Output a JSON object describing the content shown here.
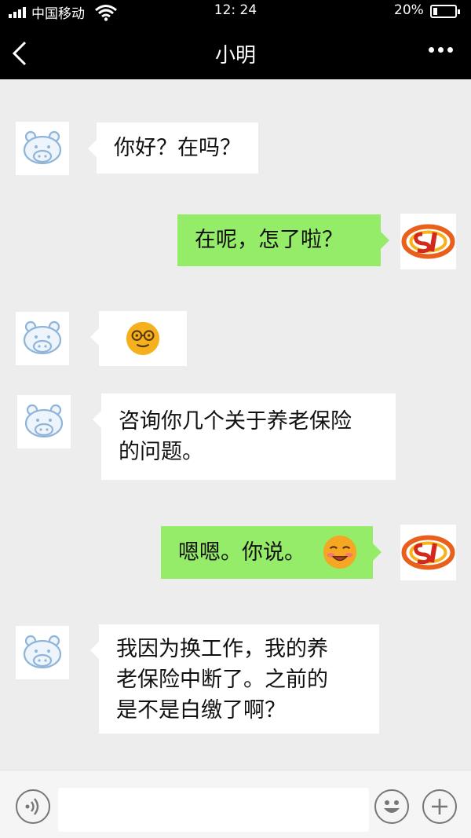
{
  "status_bar": {
    "carrier": "中国移动",
    "time": "12: 24",
    "battery": "20%",
    "battery_level": 0.2
  },
  "nav": {
    "title": "小明"
  },
  "messages": [
    {
      "from": "other",
      "text": "你好？在吗？"
    },
    {
      "from": "me",
      "text": "在呢，怎了啦？"
    },
    {
      "from": "other",
      "sticker": "nerd-glasses-emoji"
    },
    {
      "from": "other",
      "lines": [
        "咨询你几个关于养老保险",
        "的问题。"
      ]
    },
    {
      "from": "me",
      "text": "嗯嗯。你说。",
      "emoji": "blush-smile-emoji"
    },
    {
      "from": "other",
      "lines": [
        "我因为换工作，我的养",
        "老保险中断了。之前的",
        "是不是白缴了啊？"
      ]
    }
  ],
  "icons": {
    "back": "chevron-left-icon",
    "more": "more-dots-icon",
    "voice": "voice-icon",
    "emoji": "emoji-icon",
    "add": "plus-icon"
  },
  "colors": {
    "header_bg": "#000000",
    "chat_bg": "#ededed",
    "outgoing_bubble": "#95ec69",
    "incoming_bubble": "#ffffff"
  }
}
